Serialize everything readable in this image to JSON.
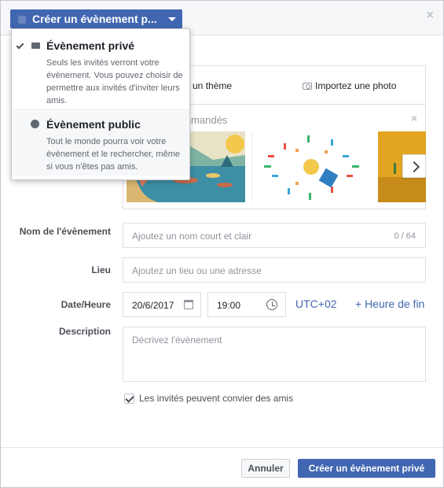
{
  "header": {
    "type_button_label": "Créer un évènement p...",
    "close": "×"
  },
  "media": {
    "tab_theme": "ssez un thème",
    "tab_photo": "Importez une photo",
    "recommended_title": "ommandés",
    "rec_close": "×"
  },
  "form": {
    "name_label": "Nom de l'évènement",
    "name_placeholder": "Ajoutez un nom court et clair",
    "name_counter": "0 / 64",
    "place_label": "Lieu",
    "place_placeholder": "Ajoutez un lieu ou une adresse",
    "datetime_label": "Date/Heure",
    "date_value": "20/6/2017",
    "time_value": "19:00",
    "timezone": "UTC+02",
    "end_time_link": "+ Heure de fin",
    "description_label": "Description",
    "description_placeholder": "Décrivez l'évènement",
    "guests_invite_label": "Les invités peuvent convier des amis"
  },
  "footer": {
    "cancel_label": "Annuler",
    "create_label": "Créer un évènement privé"
  },
  "dropdown": {
    "items": [
      {
        "title": "Évènement privé",
        "description": "Seuls les invités verront votre évènement. Vous pouvez choisir de permettre aux invités d'inviter leurs amis.",
        "icon": "envelope-icon",
        "selected": true
      },
      {
        "title": "Évènement public",
        "description": "Tout le monde pourra voir votre évènement et le rechercher, même si vous n'êtes pas amis.",
        "icon": "globe-icon",
        "selected": false
      }
    ]
  },
  "colors": {
    "primary": "#4267b2",
    "text": "#1d2129",
    "muted": "#90949c"
  }
}
